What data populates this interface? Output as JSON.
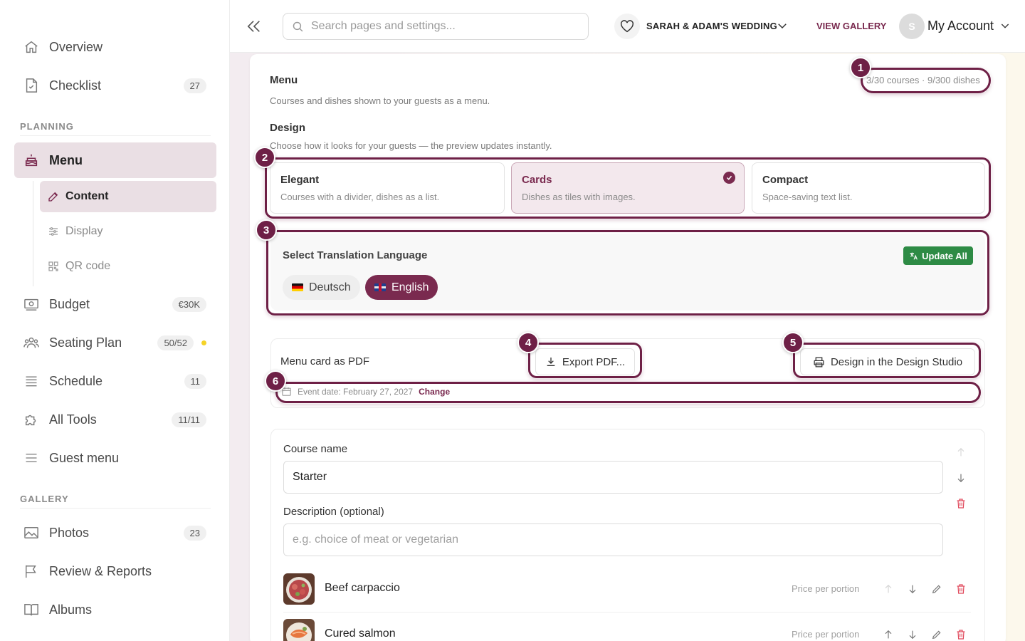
{
  "sidebar": {
    "overview": "Overview",
    "checklist": {
      "label": "Checklist",
      "badge": "27"
    },
    "planning_section": "PLANNING",
    "menu": "Menu",
    "menu_sub": {
      "content": "Content",
      "display": "Display",
      "qr": "QR code"
    },
    "budget": {
      "label": "Budget",
      "badge": "€30K"
    },
    "seating": {
      "label": "Seating Plan",
      "badge": "50/52"
    },
    "schedule": {
      "label": "Schedule",
      "badge": "11"
    },
    "tools": {
      "label": "All Tools",
      "badge": "11/11"
    },
    "guest_menu": "Guest menu",
    "gallery_section": "GALLERY",
    "photos": {
      "label": "Photos",
      "badge": "23"
    },
    "review": "Review & Reports",
    "albums": "Albums"
  },
  "header": {
    "search_placeholder": "Search pages and settings...",
    "event_name": "SARAH & ADAM'S WEDDING",
    "view_gallery": "VIEW GALLERY",
    "avatar_initial": "S",
    "account": "My Account"
  },
  "menu_card": {
    "title": "Menu",
    "description": "Courses and dishes shown to your guests as a menu.",
    "counts": "3/30 courses · 9/300 dishes",
    "design_title": "Design",
    "design_description": "Choose how it looks for your guests — the preview updates instantly.",
    "designs": [
      {
        "title": "Elegant",
        "desc": "Courses with a divider, dishes as a list."
      },
      {
        "title": "Cards",
        "desc": "Dishes as tiles with images."
      },
      {
        "title": "Compact",
        "desc": "Space-saving text list."
      }
    ],
    "translation": {
      "title": "Select Translation Language",
      "update_all": "Update All",
      "languages": [
        "Deutsch",
        "English"
      ]
    },
    "pdf": {
      "title": "Menu card as PDF",
      "export": "Export PDF...",
      "design_studio": "Design in the Design Studio",
      "event_date": "Event date: February 27, 2027",
      "change": "Change"
    },
    "course": {
      "name_label": "Course name",
      "name_value": "Starter",
      "desc_label": "Description (optional)",
      "desc_placeholder": "e.g. choice of meat or vegetarian",
      "dishes": [
        {
          "name": "Beef carpaccio",
          "price_placeholder": "Price per portion"
        },
        {
          "name": "Cured salmon",
          "price_placeholder": "Price per portion"
        }
      ]
    }
  },
  "callouts": [
    "1",
    "2",
    "3",
    "4",
    "5",
    "6"
  ],
  "colors": {
    "accent": "#7a2a4f",
    "success": "#2e8b45",
    "danger": "#e0475a"
  }
}
